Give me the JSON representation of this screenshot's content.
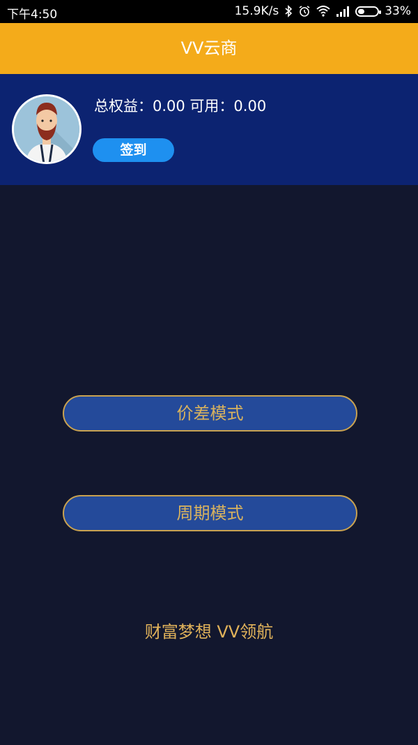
{
  "status_bar": {
    "time": "下午4:50",
    "network_speed": "15.9K/s",
    "battery": "33%",
    "battery_level": 0.33,
    "icons": [
      "bluetooth-icon",
      "alarm-icon",
      "wifi-icon",
      "signal-icon",
      "battery-icon"
    ]
  },
  "header": {
    "title": "VV云商"
  },
  "account": {
    "balance_text": "总权益：0.00 可用：0.00",
    "checkin_label": "签到"
  },
  "modes": [
    {
      "label": "价差模式"
    },
    {
      "label": "周期模式"
    }
  ],
  "footer": {
    "slogan": "财富梦想 VV领航"
  },
  "colors": {
    "header_bg": "#f4ab1a",
    "account_bg": "#0c2371",
    "page_bg": "#12172e",
    "button_bg": "#244a9a",
    "button_border": "#c9a250",
    "gold_text": "#d8b25e",
    "checkin_bg": "#1e90f0"
  }
}
